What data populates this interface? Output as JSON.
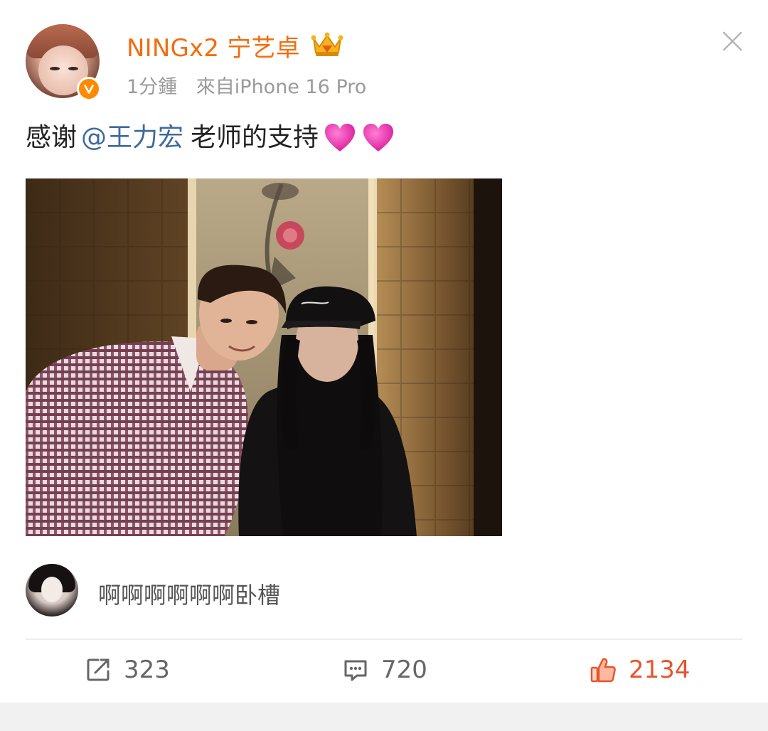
{
  "post": {
    "username": "NINGx2 宁艺卓",
    "time": "1分鍾",
    "source": "來自iPhone 16 Pro",
    "text_before": "感谢",
    "mention": "@王力宏",
    "text_after": "老师的支持"
  },
  "comment": {
    "text": "啊啊啊啊啊啊卧槽"
  },
  "actions": {
    "reposts": "323",
    "comments": "720",
    "likes": "2134"
  },
  "colors": {
    "username": "#f26d0f",
    "mention": "#3e6a9c",
    "like": "#e8542c",
    "verified_badge": "#ff8a00"
  },
  "icons": [
    "close-icon",
    "crown-icon",
    "verified-icon",
    "heart-icon",
    "repost-icon",
    "comment-icon",
    "like-icon"
  ]
}
